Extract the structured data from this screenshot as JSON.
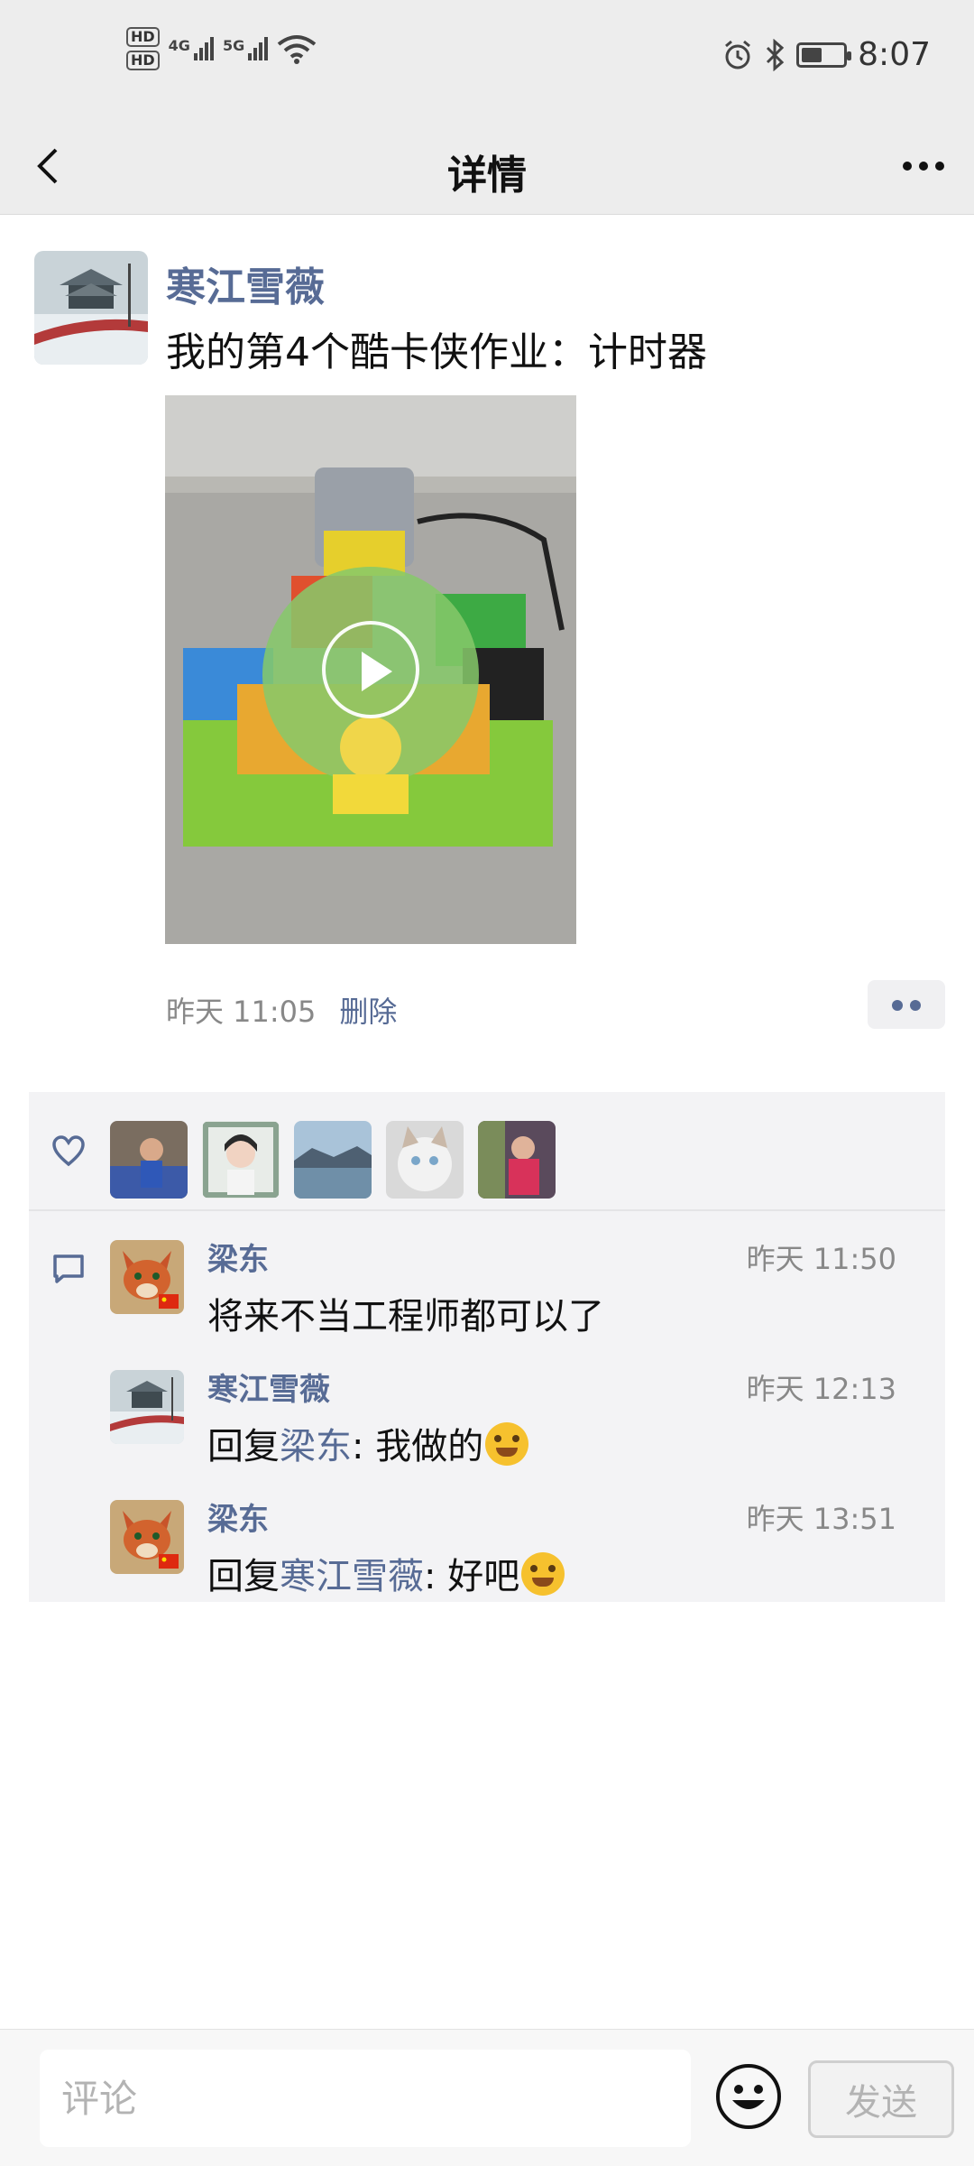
{
  "status_bar": {
    "hd1": "HD",
    "hd2": "HD",
    "net1": "4G",
    "net2": "5G",
    "time": "8:07",
    "battery_level": 0.5
  },
  "nav": {
    "title": "详情",
    "back_icon": "chevron-left-icon",
    "more_icon": "more-horizontal-icon"
  },
  "post": {
    "author": "寒江雪薇",
    "text": "我的第4个酷卡侠作业：计时器",
    "time": "昨天 11:05",
    "delete_label": "删除"
  },
  "likes": {
    "icon": "heart-icon",
    "count": 5
  },
  "comments": [
    {
      "name": "梁东",
      "time": "昨天 11:50",
      "text": "将来不当工程师都可以了",
      "reply_prefix": "",
      "reply_to": "",
      "reply_suffix": ""
    },
    {
      "name": "寒江雪薇",
      "time": "昨天 12:13",
      "reply_prefix": "回复",
      "reply_to": "梁东",
      "reply_suffix": ": 我做的"
    },
    {
      "name": "梁东",
      "time": "昨天 13:51",
      "reply_prefix": "回复",
      "reply_to": "寒江雪薇",
      "reply_suffix": ": 好吧"
    }
  ],
  "input_bar": {
    "placeholder": "评论",
    "send_label": "发送"
  },
  "colors": {
    "link": "#576b95",
    "header_bg": "#ededed",
    "panel_bg": "#f3f3f5"
  }
}
